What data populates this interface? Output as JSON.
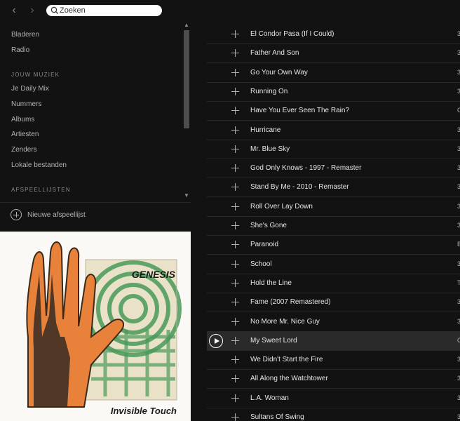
{
  "search": {
    "placeholder": "Zoeken"
  },
  "nav": {
    "main": [
      "Bladeren",
      "Radio"
    ],
    "your_music_heading": "JOUW MUZIEK",
    "your_music": [
      "Je Daily Mix",
      "Nummers",
      "Albums",
      "Artiesten",
      "Zenders",
      "Lokale bestanden"
    ],
    "playlists_heading": "AFSPEELLIJSTEN",
    "new_playlist": "Nieuwe afspeellijst"
  },
  "album": {
    "artist": "GENESIS",
    "title": "Invisible Touch",
    "colors": {
      "background": "#fbf9f6",
      "hand": "#e8823a",
      "pattern": "#4a9a5a",
      "text": "#1a1a1a"
    }
  },
  "tracks": [
    {
      "title": "El Condor Pasa (If I Could)",
      "edge": "3"
    },
    {
      "title": "Father And Son",
      "edge": "3"
    },
    {
      "title": "Go Your Own Way",
      "edge": "3"
    },
    {
      "title": "Running On",
      "edge": "3"
    },
    {
      "title": "Have You Ever Seen The Rain?",
      "edge": "C"
    },
    {
      "title": "Hurricane",
      "edge": "3"
    },
    {
      "title": "Mr. Blue Sky",
      "edge": "3"
    },
    {
      "title": "God Only Knows - 1997 - Remaster",
      "edge": "3"
    },
    {
      "title": "Stand By Me - 2010 - Remaster",
      "edge": "3"
    },
    {
      "title": "Roll Over Lay Down",
      "edge": "3"
    },
    {
      "title": "She's Gone",
      "edge": "3"
    },
    {
      "title": "Paranoid",
      "edge": "B"
    },
    {
      "title": "School",
      "edge": "3"
    },
    {
      "title": "Hold the Line",
      "edge": "T"
    },
    {
      "title": "Fame (2007 Remastered)",
      "edge": "3"
    },
    {
      "title": "No More Mr. Nice Guy",
      "edge": "3"
    },
    {
      "title": "My Sweet Lord",
      "edge": "C",
      "active": true
    },
    {
      "title": "We Didn't Start the Fire",
      "edge": "3"
    },
    {
      "title": "All Along the Watchtower",
      "edge": "3"
    },
    {
      "title": "L.A. Woman",
      "edge": "3"
    },
    {
      "title": "Sultans Of Swing",
      "edge": "3"
    }
  ],
  "icons": [
    "chevron-left-icon",
    "chevron-right-icon",
    "search-icon",
    "plus-icon",
    "play-icon"
  ]
}
